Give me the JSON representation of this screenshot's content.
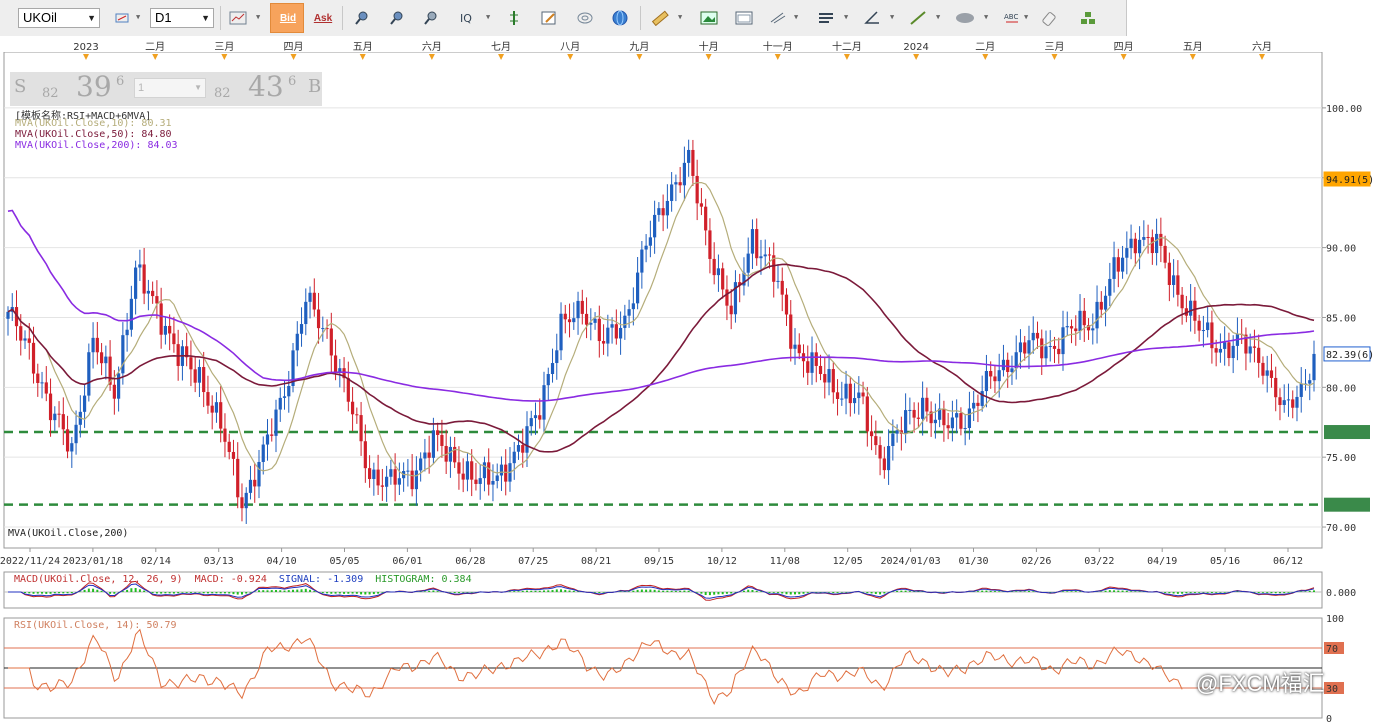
{
  "toolbar": {
    "symbol": "UKOil",
    "timeframe": "D1",
    "bid_label": "Bid",
    "ask_label": "Ask"
  },
  "quote_panel": {
    "sell_letter": "S",
    "sell_prefix": "82",
    "sell_big": "39",
    "sell_sup": "6",
    "lot": "1",
    "buy_prefix": "82",
    "buy_big": "43",
    "buy_sup": "6",
    "buy_letter": "B"
  },
  "legend": {
    "template": "[模板名称:RSI+MACD+6MVA]",
    "mva10": "MVA(UKOil.Close,10): 80.31",
    "mva50": "MVA(UKOil.Close,50): 84.80",
    "mva200": "MVA(UKOil.Close,200): 84.03",
    "bottom_label": "MVA(UKOil.Close,200)"
  },
  "macd_label": {
    "name": "MACD(UKOil.Close, 12, 26, 9)",
    "macd": "MACD: -0.924",
    "signal": "SIGNAL: -1.309",
    "hist": "HISTOGRAM: 0.384"
  },
  "rsi_label": "RSI(UKOil.Close, 14): 50.79",
  "watermark": "@FXCM福汇",
  "colors": {
    "bull": "#1f5fbf",
    "bear": "#d0202a",
    "mva10": "#b5ad7a",
    "mva50": "#7b1a3a",
    "mva200": "#8a2be2",
    "support": "#2e8b3c",
    "price_tag": "#ffa500"
  },
  "chart_data": {
    "type": "candlestick",
    "symbol": "UKOil",
    "timeframe": "D1",
    "month_labels": [
      "2023",
      "二月",
      "三月",
      "四月",
      "五月",
      "六月",
      "七月",
      "八月",
      "九月",
      "十月",
      "十一月",
      "十二月",
      "2024",
      "二月",
      "三月",
      "四月",
      "五月",
      "六月"
    ],
    "date_ticks": [
      "2022/11/24",
      "2023/01/18",
      "02/14",
      "03/13",
      "04/10",
      "05/05",
      "06/01",
      "06/28",
      "07/25",
      "08/21",
      "09/15",
      "10/12",
      "11/08",
      "12/05",
      "2024/01/03",
      "01/30",
      "02/26",
      "03/22",
      "04/19",
      "05/16",
      "06/12"
    ],
    "y_ticks": [
      "100.00",
      "95.00",
      "90.00",
      "85.00",
      "80.00",
      "75.00",
      "70.00"
    ],
    "ylim": [
      68.5,
      104
    ],
    "current_price": 82.39,
    "current_price_label": "82.39(6)",
    "marker_price": 94.91,
    "marker_label": "94.91(5)",
    "support_levels": [
      76.8,
      71.6
    ],
    "price_path": [
      [
        0,
        85
      ],
      [
        5,
        83
      ],
      [
        10,
        78
      ],
      [
        15,
        76
      ],
      [
        20,
        83
      ],
      [
        25,
        80
      ],
      [
        30,
        88
      ],
      [
        35,
        86
      ],
      [
        40,
        82
      ],
      [
        45,
        81
      ],
      [
        50,
        77
      ],
      [
        55,
        72
      ],
      [
        60,
        75
      ],
      [
        65,
        80
      ],
      [
        70,
        86
      ],
      [
        75,
        84
      ],
      [
        80,
        79
      ],
      [
        85,
        74
      ],
      [
        90,
        73
      ],
      [
        95,
        74
      ],
      [
        100,
        76
      ],
      [
        105,
        75
      ],
      [
        110,
        73
      ],
      [
        115,
        74
      ],
      [
        120,
        75
      ],
      [
        125,
        79
      ],
      [
        130,
        84
      ],
      [
        135,
        86
      ],
      [
        140,
        83
      ],
      [
        145,
        85
      ],
      [
        150,
        90
      ],
      [
        155,
        94
      ],
      [
        160,
        96
      ],
      [
        165,
        90
      ],
      [
        170,
        85
      ],
      [
        175,
        91
      ],
      [
        180,
        88
      ],
      [
        185,
        83
      ],
      [
        190,
        81
      ],
      [
        195,
        80
      ],
      [
        200,
        79
      ],
      [
        205,
        75
      ],
      [
        210,
        77
      ],
      [
        215,
        79
      ],
      [
        220,
        77
      ],
      [
        225,
        78
      ],
      [
        230,
        80
      ],
      [
        235,
        82
      ],
      [
        240,
        83
      ],
      [
        245,
        83
      ],
      [
        250,
        84
      ],
      [
        255,
        85
      ],
      [
        260,
        88
      ],
      [
        265,
        91
      ],
      [
        270,
        90
      ],
      [
        275,
        87
      ],
      [
        280,
        84
      ],
      [
        285,
        83
      ],
      [
        290,
        83
      ],
      [
        295,
        82
      ],
      [
        300,
        78
      ],
      [
        304,
        80
      ],
      [
        307,
        82.4
      ]
    ],
    "n_bars": 308,
    "mva10_last": 80.31,
    "mva50_last": 84.8,
    "mva200_last": 84.03,
    "macd": {
      "period": [
        12,
        26,
        9
      ],
      "macd": -0.924,
      "signal": -1.309,
      "histogram": 0.384,
      "ytick": "0.000"
    },
    "rsi": {
      "period": 14,
      "value": 50.79,
      "ticks": [
        "100",
        "70",
        "30",
        "0"
      ],
      "levels": [
        70,
        50,
        30
      ]
    }
  }
}
